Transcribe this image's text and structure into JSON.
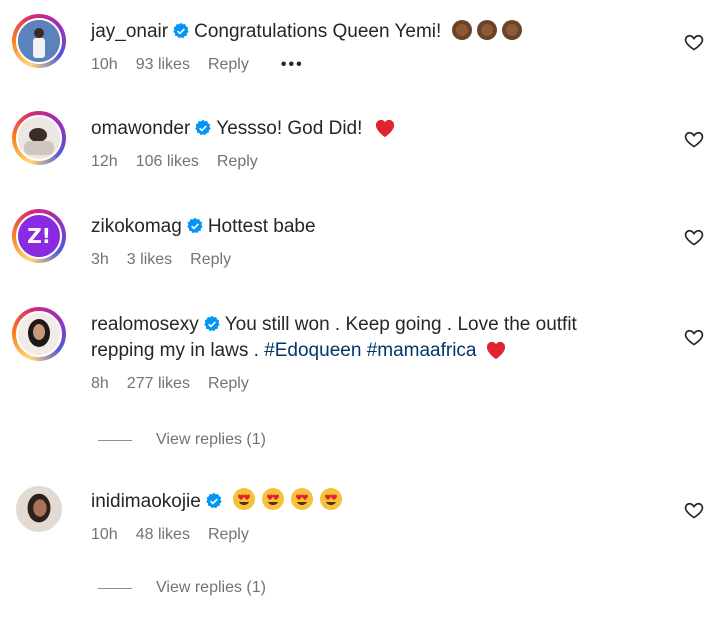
{
  "comments": [
    {
      "username": "jay_onair",
      "text": "Congratulations Queen Yemi!",
      "emoji": [
        "clap-hands-icon",
        "clap-hands-icon",
        "clap-hands-icon"
      ],
      "time": "10h",
      "likes": "93 likes",
      "reply": "Reply",
      "more": "•••"
    },
    {
      "username": "omawonder",
      "text": "Yessso! God Did!",
      "emoji": [
        "red-heart-icon"
      ],
      "time": "12h",
      "likes": "106 likes",
      "reply": "Reply"
    },
    {
      "username": "zikokomag",
      "avatar_text": "Z!",
      "text": "Hottest babe",
      "time": "3h",
      "likes": "3 likes",
      "reply": "Reply"
    },
    {
      "username": "realomosexy",
      "text": "You still won . Keep going . Love the outfit",
      "text2": "repping my in laws .",
      "hashtag1": "#Edoqueen",
      "hashtag2": "#mamaafrica",
      "emoji": [
        "red-heart-icon"
      ],
      "time": "8h",
      "likes": "277 likes",
      "reply": "Reply",
      "view_replies": "View replies (1)"
    },
    {
      "username": "inidimaokojie",
      "emoji": [
        "heart-eyes-icon",
        "heart-eyes-icon",
        "heart-eyes-icon",
        "heart-eyes-icon"
      ],
      "time": "10h",
      "likes": "48 likes",
      "reply": "Reply",
      "view_replies": "View replies (1)"
    }
  ],
  "colors": {
    "text": "#262626",
    "meta": "#737373",
    "verified": "#0095f6",
    "hashtag": "#00376b",
    "heart": "#ed4956",
    "zikoko": "#8a2be2"
  }
}
